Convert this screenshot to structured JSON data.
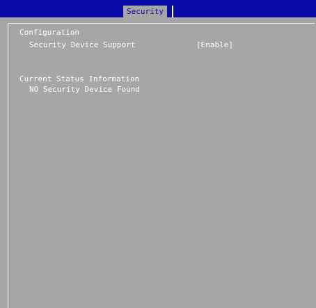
{
  "header": {
    "tab_label": "Security"
  },
  "configuration": {
    "heading": "Configuration",
    "items": [
      {
        "label": "Security Device Support",
        "value": "[Enable]"
      }
    ]
  },
  "status": {
    "heading": "Current Status Information",
    "message": "NO Security Device Found"
  },
  "colors": {
    "title_bar": "#0b0ba8",
    "background": "#a6a6a6",
    "text": "#ffffff"
  }
}
